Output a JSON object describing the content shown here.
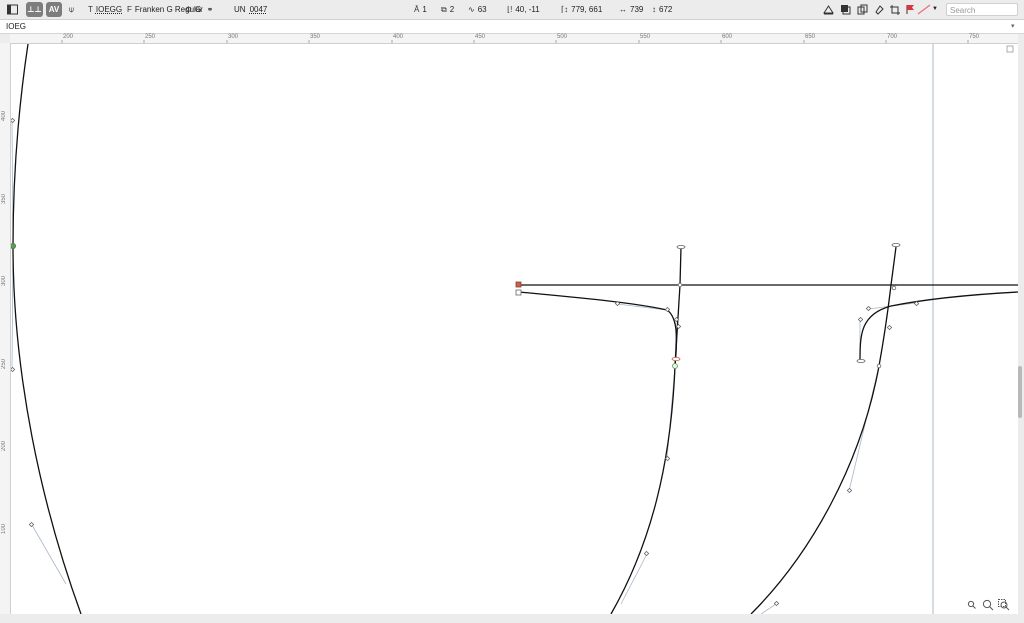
{
  "toolbar": {
    "text_label": "IOEGG",
    "font_name": "Franken G Regular",
    "glyph_name": "G",
    "unicode_label": "UN",
    "unicode_value": "0047",
    "layers_count": "1",
    "contours_count": "2",
    "nodes_count": "63",
    "sidebearings": "40, -11",
    "bbox_origin": "779, 661",
    "width": "739",
    "height": "672",
    "search_placeholder": "Search"
  },
  "text_bar": {
    "value": "IOEG"
  },
  "ruler": {
    "top_labels": [
      "200",
      "250",
      "300",
      "350",
      "400",
      "450",
      "500",
      "550",
      "600",
      "650",
      "700",
      "750"
    ],
    "left_labels": [
      "400",
      "350",
      "300",
      "250",
      "200",
      "100"
    ]
  },
  "colors": {
    "accent": "#7d7d7d",
    "curve": "#000000",
    "guide": "#a8b8cc"
  }
}
